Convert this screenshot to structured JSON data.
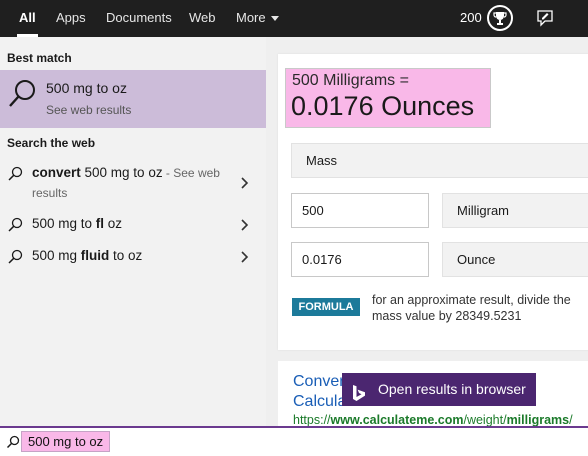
{
  "nav": {
    "tabs": [
      {
        "label": "All",
        "active": true
      },
      {
        "label": "Apps"
      },
      {
        "label": "Documents"
      },
      {
        "label": "Web"
      },
      {
        "label": "More"
      }
    ],
    "points": "200",
    "trophy_icon": "trophy-icon",
    "feedback_icon": "feedback-icon"
  },
  "left": {
    "best_match_heading": "Best match",
    "best_match": {
      "title": "500 mg to oz",
      "subtitle": "See web results",
      "icon": "search-icon"
    },
    "search_web_heading": "Search the web",
    "suggestions": [
      {
        "bold": "convert",
        "rest": " 500 mg to oz",
        "muted": " - See web results"
      },
      {
        "pre": "500 mg to ",
        "bold": "fl",
        "post": " oz"
      },
      {
        "pre": "500 mg ",
        "bold": "fluid",
        "post": " to oz"
      }
    ]
  },
  "right": {
    "converter": {
      "result_small": "500 Milligrams =",
      "result_big": "0.0176 Ounces",
      "category": "Mass",
      "from_value": "500",
      "from_unit": "Milligram",
      "to_value": "0.0176",
      "to_unit": "Ounce",
      "formula_label": "FORMULA",
      "formula_text": "for an approximate result, divide the mass value by 28349.5231"
    },
    "web_result": {
      "title_line1": "Conver",
      "title_tail": "-",
      "title_line2": "Calculat",
      "url_prefix": "https://",
      "url_domain": "www.calculateme.com",
      "url_path1": "/weight/",
      "url_bold2": "milligrams",
      "url_path2": "/"
    },
    "open_button": "Open results in browser"
  },
  "search": {
    "query": "500 mg to oz",
    "icon": "search-icon"
  },
  "colors": {
    "nav_bg": "#1f1f1f",
    "selected_bg": "#ccbcd9",
    "highlight_pink": "#f9b8e8",
    "formula_badge": "#1c7a9a",
    "open_button_bg": "#4b2670",
    "link_blue": "#1a5eb6",
    "url_green": "#1b7a2a"
  }
}
